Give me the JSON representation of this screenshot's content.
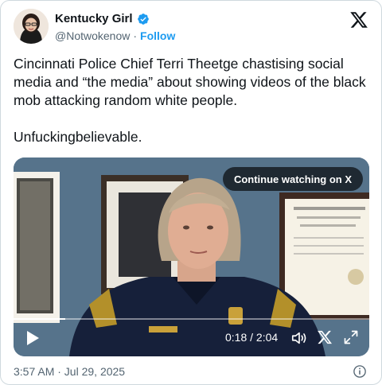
{
  "author": {
    "display_name": "Kentucky Girl",
    "handle": "@Notwokenow",
    "separator": "·",
    "follow_label": "Follow"
  },
  "tweet": {
    "text": "Cincinnati Police Chief Terri Theetge chastising social media and “the media” about showing videos of the black mob attacking random white people.\n\nUnfuckingbelievable."
  },
  "video": {
    "continue_label": "Continue watching on X",
    "time_display": "0:18 / 2:04",
    "progress_fraction": 0.145
  },
  "footer": {
    "timestamp": "3:57 AM · Jul 29, 2025"
  },
  "colors": {
    "accent": "#1d9bf0",
    "text": "#0f1419",
    "muted": "#536471"
  },
  "icons": [
    "verified-badge-icon",
    "x-logo-icon",
    "play-icon",
    "volume-icon",
    "x-icon",
    "fullscreen-icon",
    "info-icon"
  ]
}
